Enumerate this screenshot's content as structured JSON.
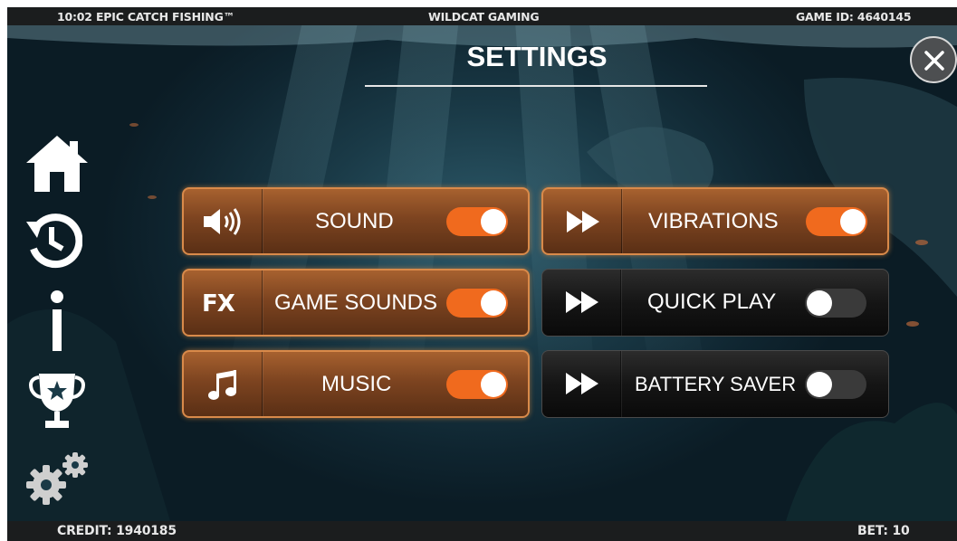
{
  "header": {
    "game_title": "10:02 EPIC CATCH FISHING™",
    "provider": "WILDCAT GAMING",
    "game_id": "GAME ID: 4640145"
  },
  "settings": {
    "title": "SETTINGS",
    "close_icon": "close-icon",
    "options": [
      {
        "label": "SOUND",
        "icon": "speaker-icon",
        "enabled": true
      },
      {
        "label": "VIBRATIONS",
        "icon": "fast-forward-icon",
        "enabled": true
      },
      {
        "label": "GAME SOUNDS",
        "icon": "fx-icon",
        "icon_text": "FX",
        "enabled": true
      },
      {
        "label": "QUICK PLAY",
        "icon": "fast-forward-icon",
        "enabled": false
      },
      {
        "label": "MUSIC",
        "icon": "music-note-icon",
        "enabled": true
      },
      {
        "label": "BATTERY SAVER",
        "icon": "fast-forward-icon",
        "enabled": false
      }
    ]
  },
  "sidebar": {
    "items": [
      {
        "icon": "home-icon"
      },
      {
        "icon": "history-icon"
      },
      {
        "icon": "info-icon"
      },
      {
        "icon": "trophy-icon"
      },
      {
        "icon": "settings-gears-icon"
      }
    ]
  },
  "footer": {
    "credit": "CREDIT: 1940185",
    "bet": "BET: 10"
  },
  "colors": {
    "toggle_on": "#f06a1e",
    "toggle_off": "#3a3a3a",
    "panel_on": "#7d4420",
    "panel_off": "#151515"
  }
}
